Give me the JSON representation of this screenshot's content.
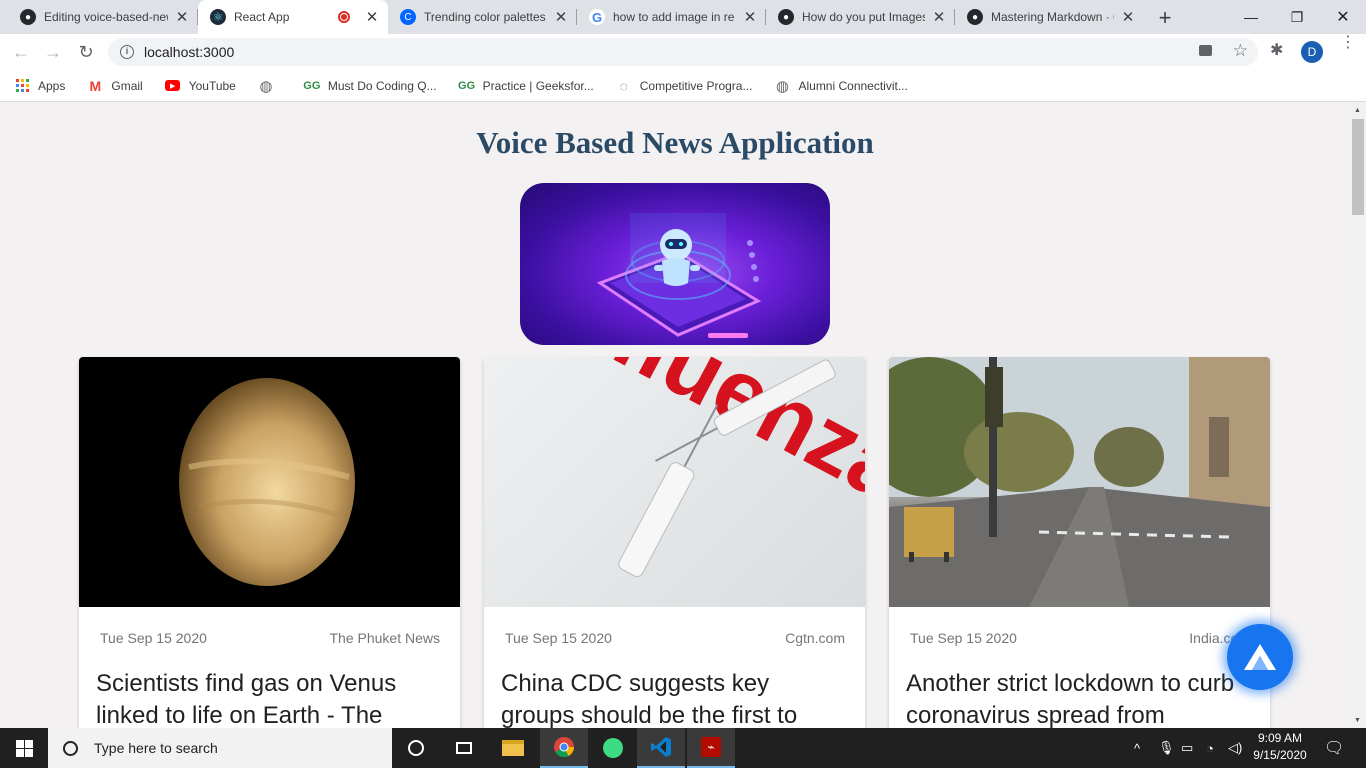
{
  "tabs": [
    {
      "title": "Editing voice-based-news",
      "icon": "github-icon",
      "active": false
    },
    {
      "title": "React App",
      "icon": "react-icon",
      "active": true
    },
    {
      "title": "Trending color palettes",
      "icon": "coolors-icon",
      "active": false
    },
    {
      "title": "how to add image in re",
      "icon": "google-icon",
      "active": false
    },
    {
      "title": "How do you put Images",
      "icon": "github-icon",
      "active": false
    },
    {
      "title": "Mastering Markdown · G",
      "icon": "github-icon",
      "active": false
    }
  ],
  "address_bar": {
    "url": "localhost:3000"
  },
  "profile_initial": "D",
  "bookmarks": [
    {
      "label": "Apps",
      "icon": "apps-grid-icon"
    },
    {
      "label": "Gmail",
      "icon": "gmail-icon"
    },
    {
      "label": "YouTube",
      "icon": "youtube-icon"
    },
    {
      "label": "",
      "icon": "globe-icon"
    },
    {
      "label": "Must Do Coding Q...",
      "icon": "geeksforgeeks-icon"
    },
    {
      "label": "Practice | Geeksfor...",
      "icon": "geeksforgeeks-icon"
    },
    {
      "label": "Competitive Progra...",
      "icon": "loading-icon"
    },
    {
      "label": "Alumni Connectivit...",
      "icon": "globe-icon"
    }
  ],
  "page": {
    "title": "Voice Based News Application"
  },
  "cards": [
    {
      "date": "Tue Sep 15 2020",
      "source": "The Phuket News",
      "headline": "Scientists find gas on Venus linked to life on Earth - The"
    },
    {
      "date": "Tue Sep 15 2020",
      "source": "Cgtn.com",
      "headline": "China CDC suggests key groups should be the first to take flu"
    },
    {
      "date": "Tue Sep 15 2020",
      "source": "India.com",
      "headline": "Another strict lockdown to curb coronavirus spread from"
    }
  ],
  "taskbar": {
    "search_placeholder": "Type here to search",
    "time": "9:09 AM",
    "date": "9/15/2020"
  },
  "colors": {
    "title": "#2a4a66",
    "fab": "#1875f0",
    "taskbar": "#202020"
  }
}
